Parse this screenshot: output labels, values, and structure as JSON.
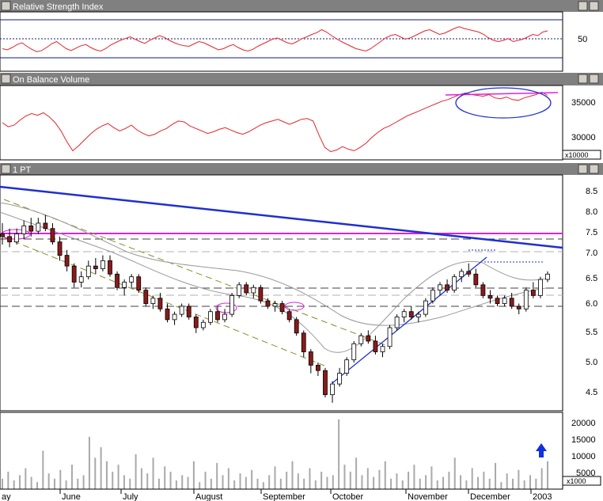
{
  "colors": {
    "titlebar": "#808080",
    "rsi_line": "#e8232a",
    "obv_line": "#e8232a",
    "up_candle": "#ffffff",
    "down_candle": "#8b1a1a",
    "trendline_blue": "#1f2fd1",
    "resistance_magenta": "#e020e0",
    "channel_olive": "#8c8c2a",
    "ma_gray": "#999999",
    "volume_bar": "#a9a9a9",
    "arrow_blue": "#1030e0"
  },
  "panels": {
    "rsi": {
      "title": "Relative Strength Index",
      "ticks": [
        "50"
      ]
    },
    "obv": {
      "title": "On Balance Volume",
      "ticks": [
        "35000",
        "30000"
      ],
      "unit": "x10000"
    },
    "price": {
      "title": "1 PT",
      "ticks": [
        "8.5",
        "8.0",
        "7.5",
        "7.0",
        "6.5",
        "6.0",
        "5.5",
        "5.0",
        "4.5"
      ]
    },
    "volume": {
      "ticks": [
        "20000",
        "15000",
        "10000",
        "5000"
      ],
      "unit": "x1000"
    }
  },
  "x_axis": {
    "months": [
      "ay",
      "June",
      "July",
      "August",
      "September",
      "October",
      "November",
      "December",
      "2003"
    ]
  },
  "chart_data": [
    {
      "type": "line",
      "panel": "rsi",
      "title": "Relative Strength Index",
      "ylim": [
        0,
        100
      ],
      "reference_lines": [
        30,
        50,
        70
      ],
      "series": [
        {
          "values": [
            38,
            36,
            40,
            45,
            48,
            42,
            37,
            33,
            35,
            40,
            46,
            50,
            44,
            38,
            35,
            39,
            43,
            45,
            40,
            36,
            34,
            38,
            44,
            48,
            52,
            55,
            58,
            54,
            50,
            47,
            52,
            56,
            60,
            57,
            52,
            48,
            45,
            43,
            42,
            46,
            50,
            48,
            44,
            40,
            36,
            38,
            42,
            45,
            40,
            36,
            34,
            37,
            42,
            46,
            50,
            54,
            56,
            52,
            48,
            46,
            50,
            55,
            58,
            62,
            65,
            70,
            66,
            60,
            55,
            50,
            46,
            42,
            38,
            36,
            34,
            38,
            44,
            50,
            56,
            60,
            62,
            58,
            54,
            56,
            60,
            64,
            68,
            70,
            66,
            62,
            64,
            68,
            72,
            75,
            72,
            70,
            68,
            66,
            62,
            56,
            52,
            50,
            52,
            55,
            50,
            52,
            54,
            58,
            62,
            60,
            66,
            68
          ]
        }
      ]
    },
    {
      "type": "line",
      "panel": "obv",
      "title": "On Balance Volume",
      "ylim": [
        28000,
        37000
      ],
      "series": [
        {
          "values": [
            32500,
            32000,
            32200,
            32800,
            33300,
            33600,
            33400,
            33700,
            33200,
            32500,
            31500,
            30200,
            29100,
            29700,
            30400,
            31100,
            31700,
            32100,
            32400,
            31900,
            31500,
            31800,
            32200,
            31600,
            31200,
            30900,
            31100,
            31500,
            31800,
            32300,
            32700,
            32600,
            32100,
            31800,
            31500,
            31200,
            31400,
            31700,
            31900,
            31600,
            31300,
            31100,
            31400,
            31800,
            32200,
            32500,
            32700,
            32900,
            32600,
            32300,
            32600,
            32900,
            33000,
            32700,
            31000,
            29500,
            29000,
            29200,
            29600,
            29300,
            29100,
            29500,
            30000,
            30700,
            31300,
            31800,
            32100,
            32500,
            32900,
            33300,
            33600,
            33900,
            34200,
            34500,
            34800,
            35100,
            35300,
            35600,
            35900,
            36100,
            35900,
            35800,
            35700,
            35900,
            35500,
            35400,
            35600,
            35300,
            35200,
            35500,
            35700,
            35900,
            36200,
            35800
          ]
        }
      ]
    },
    {
      "type": "candlestick",
      "panel": "price",
      "title": "1 PT",
      "ylim": [
        4.3,
        8.7
      ],
      "series": [
        {
          "values": [
            [
              7.6,
              7.8,
              7.4,
              7.55
            ],
            [
              7.55,
              7.7,
              7.35,
              7.45
            ],
            [
              7.45,
              7.7,
              7.4,
              7.6
            ],
            [
              7.6,
              7.85,
              7.5,
              7.75
            ],
            [
              7.75,
              7.9,
              7.55,
              7.65
            ],
            [
              7.65,
              7.9,
              7.6,
              7.8
            ],
            [
              7.8,
              7.95,
              7.65,
              7.7
            ],
            [
              7.7,
              7.8,
              7.4,
              7.45
            ],
            [
              7.45,
              7.55,
              7.1,
              7.2
            ],
            [
              7.2,
              7.3,
              6.9,
              7.0
            ],
            [
              7.0,
              7.05,
              6.6,
              6.7
            ],
            [
              6.7,
              6.9,
              6.6,
              6.8
            ],
            [
              6.8,
              7.1,
              6.75,
              7.0
            ],
            [
              7.0,
              7.15,
              6.85,
              6.95
            ],
            [
              6.95,
              7.2,
              6.9,
              7.1
            ],
            [
              7.1,
              7.2,
              6.8,
              6.85
            ],
            [
              6.85,
              6.9,
              6.55,
              6.6
            ],
            [
              6.6,
              6.75,
              6.45,
              6.7
            ],
            [
              6.7,
              6.85,
              6.6,
              6.8
            ],
            [
              6.8,
              6.85,
              6.5,
              6.55
            ],
            [
              6.55,
              6.6,
              6.25,
              6.3
            ],
            [
              6.3,
              6.45,
              6.2,
              6.4
            ],
            [
              6.4,
              6.5,
              6.15,
              6.2
            ],
            [
              6.2,
              6.3,
              5.95,
              6.0
            ],
            [
              6.0,
              6.15,
              5.9,
              6.1
            ],
            [
              6.1,
              6.3,
              6.05,
              6.25
            ],
            [
              6.25,
              6.3,
              6.0,
              6.05
            ],
            [
              6.05,
              6.1,
              5.75,
              5.85
            ],
            [
              5.85,
              6.0,
              5.8,
              5.95
            ],
            [
              5.95,
              6.2,
              5.9,
              6.15
            ],
            [
              6.15,
              6.25,
              5.95,
              6.0
            ],
            [
              6.0,
              6.2,
              5.95,
              6.1
            ],
            [
              6.1,
              6.5,
              6.05,
              6.45
            ],
            [
              6.45,
              6.7,
              6.4,
              6.65
            ],
            [
              6.65,
              6.7,
              6.45,
              6.5
            ],
            [
              6.5,
              6.65,
              6.4,
              6.6
            ],
            [
              6.6,
              6.65,
              6.3,
              6.35
            ],
            [
              6.35,
              6.4,
              6.2,
              6.25
            ],
            [
              6.25,
              6.35,
              6.15,
              6.3
            ],
            [
              6.3,
              6.35,
              6.1,
              6.15
            ],
            [
              6.15,
              6.2,
              5.95,
              6.0
            ],
            [
              6.0,
              6.05,
              5.7,
              5.75
            ],
            [
              5.75,
              5.8,
              5.3,
              5.4
            ],
            [
              5.4,
              5.45,
              5.0,
              5.15
            ],
            [
              5.15,
              5.2,
              4.95,
              5.05
            ],
            [
              5.05,
              5.1,
              4.55,
              4.6
            ],
            [
              4.6,
              4.85,
              4.45,
              4.8
            ],
            [
              4.8,
              5.1,
              4.75,
              5.0
            ],
            [
              5.0,
              5.3,
              4.95,
              5.25
            ],
            [
              5.25,
              5.6,
              5.2,
              5.55
            ],
            [
              5.55,
              5.75,
              5.5,
              5.7
            ],
            [
              5.7,
              5.8,
              5.55,
              5.6
            ],
            [
              5.6,
              5.7,
              5.35,
              5.4
            ],
            [
              5.4,
              5.55,
              5.3,
              5.5
            ],
            [
              5.5,
              5.9,
              5.45,
              5.85
            ],
            [
              5.85,
              6.1,
              5.8,
              6.05
            ],
            [
              6.05,
              6.2,
              5.95,
              6.15
            ],
            [
              6.15,
              6.25,
              6.0,
              6.05
            ],
            [
              6.05,
              6.15,
              5.95,
              6.1
            ],
            [
              6.1,
              6.4,
              6.05,
              6.35
            ],
            [
              6.35,
              6.6,
              6.3,
              6.55
            ],
            [
              6.55,
              6.7,
              6.45,
              6.65
            ],
            [
              6.65,
              6.75,
              6.5,
              6.55
            ],
            [
              6.55,
              6.85,
              6.5,
              6.8
            ],
            [
              6.8,
              6.95,
              6.7,
              6.9
            ],
            [
              6.9,
              7.05,
              6.8,
              6.85
            ],
            [
              6.85,
              6.95,
              6.6,
              6.65
            ],
            [
              6.65,
              6.7,
              6.4,
              6.45
            ],
            [
              6.45,
              6.55,
              6.3,
              6.4
            ],
            [
              6.4,
              6.45,
              6.25,
              6.3
            ],
            [
              6.3,
              6.45,
              6.25,
              6.4
            ],
            [
              6.4,
              6.5,
              6.2,
              6.25
            ],
            [
              6.25,
              6.3,
              6.1,
              6.2
            ],
            [
              6.2,
              6.6,
              6.15,
              6.55
            ],
            [
              6.55,
              6.7,
              6.4,
              6.45
            ],
            [
              6.45,
              6.8,
              6.4,
              6.75
            ],
            [
              6.75,
              6.9,
              6.7,
              6.85
            ]
          ]
        }
      ]
    },
    {
      "type": "bar",
      "panel": "volume",
      "ylim": [
        0,
        22000
      ],
      "series": [
        {
          "values": [
            3000,
            5000,
            2500,
            4000,
            6000,
            3500,
            2000,
            11000,
            4500,
            3000,
            5500,
            2500,
            7000,
            3000,
            4000,
            15000,
            9000,
            12000,
            8000,
            5000,
            7000,
            4000,
            3000,
            10000,
            6000,
            4500,
            9000,
            3000,
            6500,
            5000,
            2500,
            4000,
            3500,
            8000,
            2000,
            5000,
            3000,
            7500,
            4000,
            6000,
            2500,
            4500,
            3500,
            5500,
            3000,
            2000,
            4000,
            6500,
            3000,
            5000,
            8000,
            4500,
            3000,
            6000,
            2500,
            5000,
            3500,
            4000,
            20000,
            7000,
            5000,
            9000,
            4000,
            6000,
            3500,
            5500,
            8000,
            3000,
            4500,
            2500,
            5000,
            7000,
            3000,
            4000,
            6500,
            2500,
            3500,
            5000,
            9000,
            4000,
            2500,
            6000,
            3500,
            5000,
            3000,
            7500,
            2000,
            4500,
            3000,
            5500,
            2500,
            4000,
            3000,
            6000,
            8000
          ]
        }
      ]
    }
  ]
}
